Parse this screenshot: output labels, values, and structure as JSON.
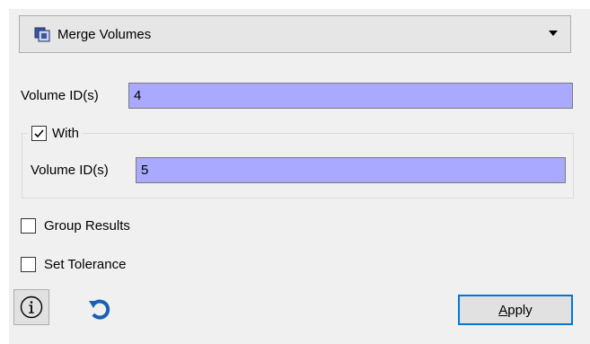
{
  "operation_select": {
    "selected": "Merge Volumes",
    "icon": "merge-volumes-icon"
  },
  "primary": {
    "label": "Volume ID(s)",
    "value": "4"
  },
  "with_group": {
    "label": "With",
    "checked": true,
    "field_label": "Volume ID(s)",
    "field_value": "5"
  },
  "options": {
    "group_results": {
      "label": "Group Results",
      "checked": false
    },
    "set_tolerance": {
      "label": "Set Tolerance",
      "checked": false
    }
  },
  "buttons": {
    "info_icon": "info-icon",
    "reset_icon": "reset-icon",
    "apply_mnemonic": "A",
    "apply_rest": "pply"
  },
  "colors": {
    "input_bg": "#a9a9ff",
    "accent": "#0078d7",
    "reset_blue": "#1a5fb4"
  }
}
